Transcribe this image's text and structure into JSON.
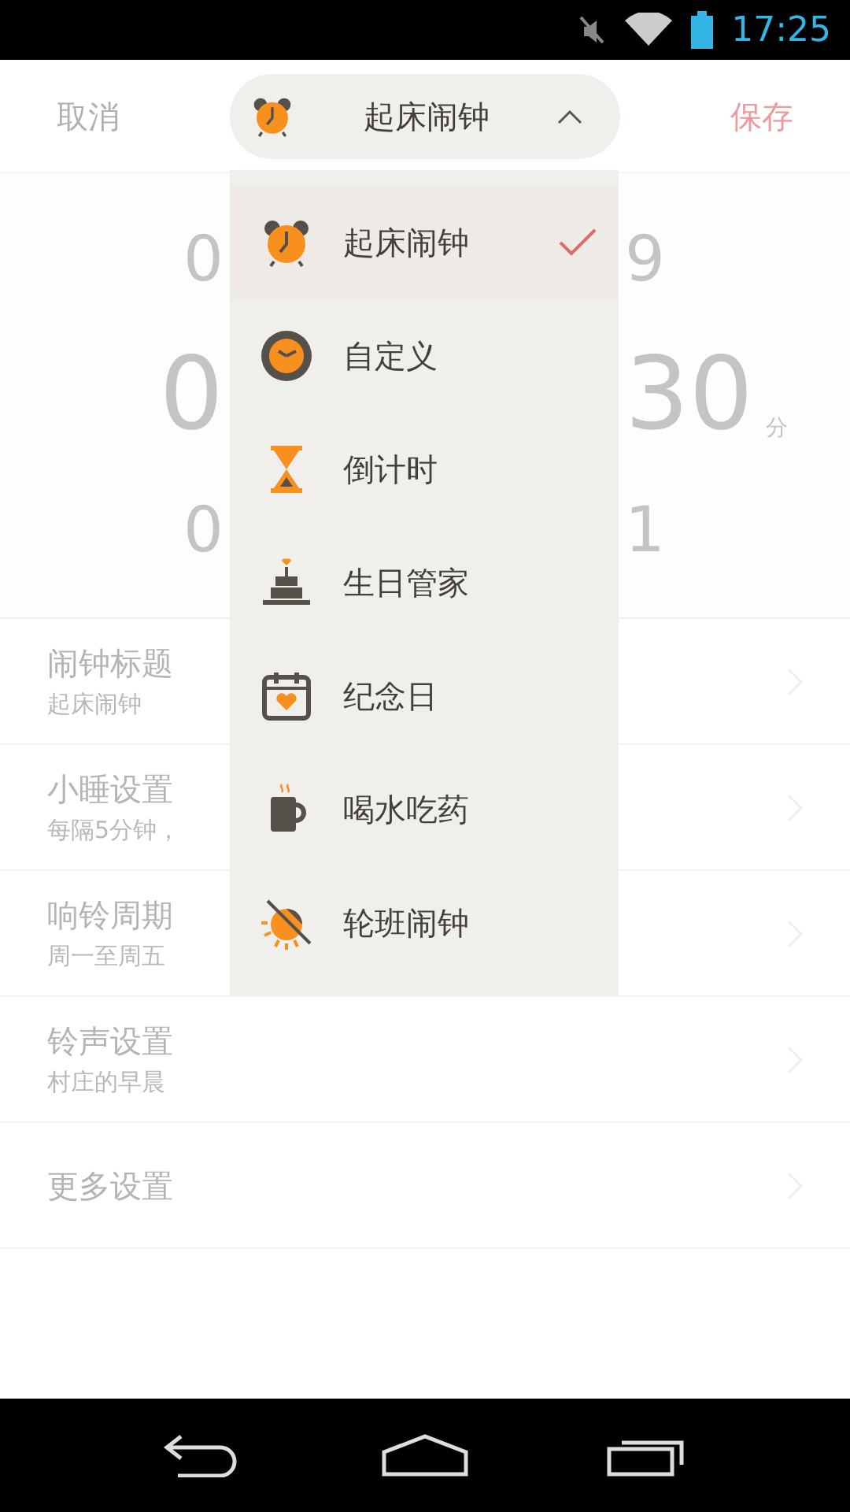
{
  "status_bar": {
    "time": "17:25"
  },
  "header": {
    "cancel": "取消",
    "save": "保存",
    "type_selector": {
      "label": "起床闹钟",
      "expanded": true
    }
  },
  "time_picker": {
    "hours": [
      "0",
      "0",
      "0"
    ],
    "minutes": [
      "9",
      "30",
      "1"
    ],
    "minute_unit": "分"
  },
  "settings": [
    {
      "title": "闹钟标题",
      "subtitle": "起床闹钟"
    },
    {
      "title": "小睡设置",
      "subtitle": "每隔5分钟，"
    },
    {
      "title": "响铃周期",
      "subtitle": "周一至周五"
    },
    {
      "title": "铃声设置",
      "subtitle": "村庄的早晨"
    },
    {
      "title": "更多设置"
    }
  ],
  "menu": [
    {
      "kind": "alarm",
      "label": "起床闹钟",
      "selected": true
    },
    {
      "kind": "custom",
      "label": "自定义",
      "selected": false
    },
    {
      "kind": "countdown",
      "label": "倒计时",
      "selected": false
    },
    {
      "kind": "birthday",
      "label": "生日管家",
      "selected": false
    },
    {
      "kind": "anniversary",
      "label": "纪念日",
      "selected": false
    },
    {
      "kind": "medicine",
      "label": "喝水吃药",
      "selected": false
    },
    {
      "kind": "shift",
      "label": "轮班闹钟",
      "selected": false
    }
  ]
}
